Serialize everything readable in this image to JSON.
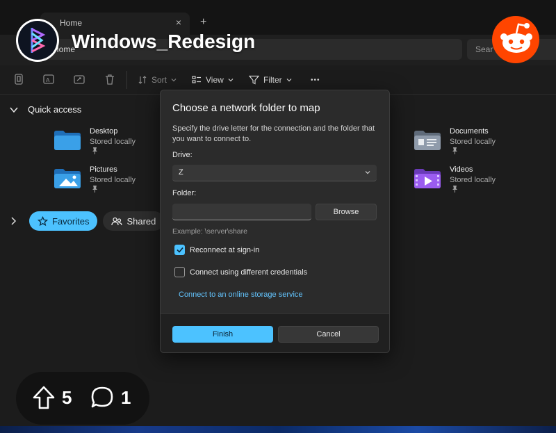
{
  "explorer": {
    "tab_title": "Home",
    "tab_close": "×",
    "tab_new": "+",
    "address_text": "Home",
    "search_placeholder": "Sear",
    "toolbar": {
      "sort_label": "Sort",
      "view_label": "View",
      "filter_label": "Filter",
      "more_label": "•••"
    },
    "quick_access": {
      "title": "Quick access",
      "items": [
        {
          "name": "Desktop",
          "status": "Stored locally",
          "icon": "folder-icon"
        },
        {
          "name": "Pictures",
          "status": "Stored locally",
          "icon": "pictures-folder-icon"
        },
        {
          "name": "Documents",
          "status": "Stored locally",
          "icon": "documents-folder-icon"
        },
        {
          "name": "Videos",
          "status": "Stored locally",
          "icon": "videos-folder-icon"
        }
      ]
    },
    "filter_chips": {
      "favorites": "Favorites",
      "shared": "Shared"
    }
  },
  "dialog": {
    "title": "Choose a network folder to map",
    "description": "Specify the drive letter for the connection and the folder that you want to connect to.",
    "drive_label": "Drive:",
    "drive_value": "Z",
    "folder_label": "Folder:",
    "folder_value": "",
    "browse_label": "Browse",
    "example_text": "Example: \\server\\share",
    "reconnect_label": "Reconnect at sign-in",
    "reconnect_checked": true,
    "credentials_label": "Connect using different credentials",
    "credentials_checked": false,
    "online_link": "Connect to an online storage service",
    "finish_label": "Finish",
    "cancel_label": "Cancel"
  },
  "reddit": {
    "subreddit": "Windows_Redesign",
    "upvotes": "5",
    "comments": "1",
    "accent_color": "#ff4500"
  }
}
